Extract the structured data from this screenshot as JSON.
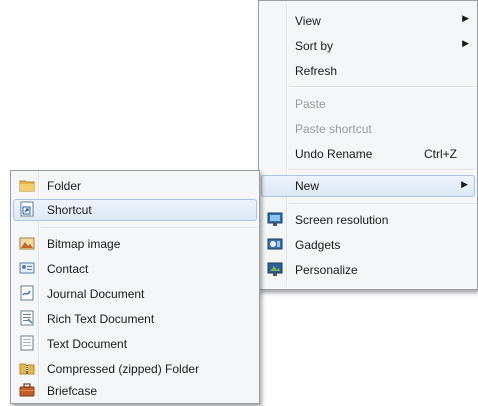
{
  "context_menu": {
    "items": [
      {
        "label": "View",
        "submenu": true
      },
      {
        "label": "Sort by",
        "submenu": true
      },
      {
        "label": "Refresh"
      },
      {
        "label": "Paste",
        "disabled": true
      },
      {
        "label": "Paste shortcut",
        "disabled": true
      },
      {
        "label": "Undo Rename",
        "shortcut": "Ctrl+Z"
      },
      {
        "label": "New",
        "submenu": true,
        "highlighted": true
      },
      {
        "label": "Screen resolution",
        "icon": "screen-resolution-icon"
      },
      {
        "label": "Gadgets",
        "icon": "gadgets-icon"
      },
      {
        "label": "Personalize",
        "icon": "personalize-icon"
      }
    ]
  },
  "new_submenu": {
    "items": [
      {
        "label": "Folder",
        "icon": "folder-icon"
      },
      {
        "label": "Shortcut",
        "icon": "shortcut-icon",
        "highlighted": true
      },
      {
        "label": "Bitmap image",
        "icon": "bitmap-image-icon"
      },
      {
        "label": "Contact",
        "icon": "contact-icon"
      },
      {
        "label": "Journal Document",
        "icon": "journal-document-icon"
      },
      {
        "label": "Rich Text Document",
        "icon": "rich-text-document-icon"
      },
      {
        "label": "Text Document",
        "icon": "text-document-icon"
      },
      {
        "label": "Compressed (zipped) Folder",
        "icon": "zipped-folder-icon"
      },
      {
        "label": "Briefcase",
        "icon": "briefcase-icon"
      }
    ]
  },
  "colors": {
    "menu_background": "#f5f6f7",
    "menu_border": "#9a9ea3",
    "highlight_fill": "#dce8f5",
    "highlight_border": "#a9c5e8",
    "disabled_text": "#9b9b9b"
  }
}
